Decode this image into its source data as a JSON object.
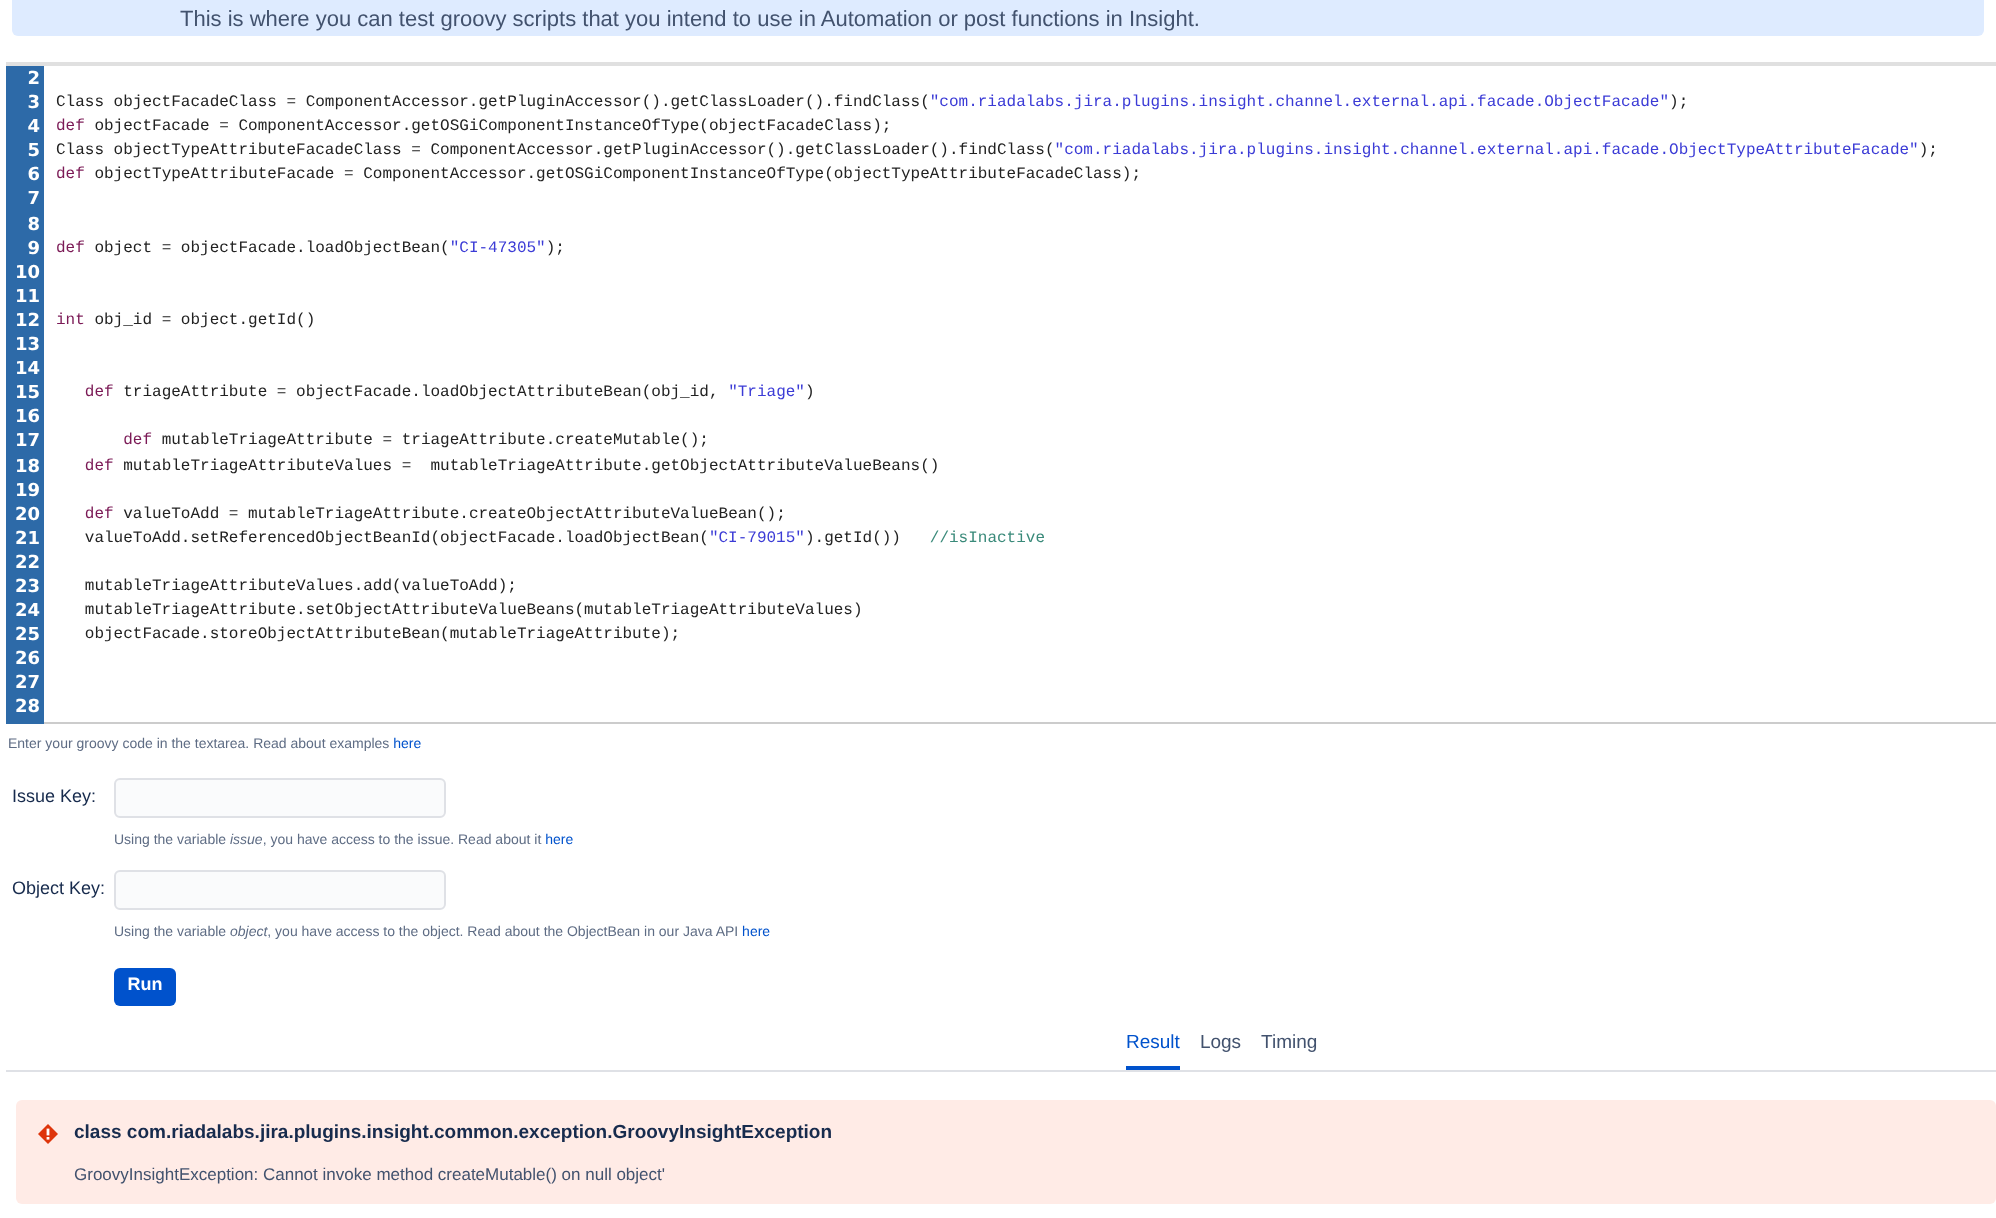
{
  "banner": {
    "text": "This is where you can test groovy scripts that you intend to use in Automation or post functions in Insight."
  },
  "editor": {
    "lines": [
      {
        "number": "2"
      },
      {
        "number": "3",
        "tokens": [
          {
            "kind": "plain",
            "text": "Class objectFacadeClass = ComponentAccessor.getPluginAccessor().getClassLoader().findClass("
          },
          {
            "kind": "string",
            "text": "\"com.riadalabs.jira.plugins.insight.channel.external.api.facade.ObjectFacade\""
          },
          {
            "kind": "plain",
            "text": ");"
          }
        ]
      },
      {
        "number": "4",
        "tokens": [
          {
            "kind": "keyword",
            "text": "def"
          },
          {
            "kind": "plain",
            "text": " objectFacade = ComponentAccessor.getOSGiComponentInstanceOfType(objectFacadeClass);"
          }
        ]
      },
      {
        "number": "5",
        "tokens": [
          {
            "kind": "plain",
            "text": "Class objectTypeAttributeFacadeClass = ComponentAccessor.getPluginAccessor().getClassLoader().findClass("
          },
          {
            "kind": "string",
            "text": "\"com.riadalabs.jira.plugins.insight.channel.external.api.facade.ObjectTypeAttributeFacade\""
          },
          {
            "kind": "plain",
            "text": ");"
          }
        ]
      },
      {
        "number": "6",
        "tokens": [
          {
            "kind": "keyword",
            "text": "def"
          },
          {
            "kind": "plain",
            "text": " objectTypeAttributeFacade = ComponentAccessor.getOSGiComponentInstanceOfType(objectTypeAttributeFacadeClass);"
          }
        ]
      },
      {
        "number": "7"
      },
      {
        "number": "8"
      },
      {
        "number": "9",
        "tokens": [
          {
            "kind": "keyword",
            "text": "def"
          },
          {
            "kind": "plain",
            "text": " object = objectFacade.loadObjectBean("
          },
          {
            "kind": "string",
            "text": "\"CI-47305\""
          },
          {
            "kind": "plain",
            "text": ");"
          }
        ]
      },
      {
        "number": "10"
      },
      {
        "number": "11"
      },
      {
        "number": "12",
        "tokens": [
          {
            "kind": "keyword",
            "text": "int"
          },
          {
            "kind": "plain",
            "text": " obj_id = object.getId()"
          }
        ]
      },
      {
        "number": "13"
      },
      {
        "number": "14"
      },
      {
        "number": "15",
        "tokens": [
          {
            "kind": "keyword",
            "text": "   def"
          },
          {
            "kind": "plain",
            "text": " triageAttribute = objectFacade.loadObjectAttributeBean(obj_id, "
          },
          {
            "kind": "string",
            "text": "\"Triage\""
          },
          {
            "kind": "plain",
            "text": ")"
          }
        ]
      },
      {
        "number": "16"
      },
      {
        "number": "17",
        "tokens": [
          {
            "kind": "keyword",
            "text": "       def"
          },
          {
            "kind": "plain",
            "text": " mutableTriageAttribute = triageAttribute.createMutable();"
          }
        ]
      },
      {
        "number": "18",
        "tokens": [
          {
            "kind": "keyword",
            "text": "   def"
          },
          {
            "kind": "plain",
            "text": " mutableTriageAttributeValues =  mutableTriageAttribute.getObjectAttributeValueBeans()"
          }
        ]
      },
      {
        "number": "19"
      },
      {
        "number": "20",
        "tokens": [
          {
            "kind": "keyword",
            "text": "   def"
          },
          {
            "kind": "plain",
            "text": " valueToAdd = mutableTriageAttribute.createObjectAttributeValueBean();"
          }
        ]
      },
      {
        "number": "21",
        "tokens": [
          {
            "kind": "plain",
            "text": "   valueToAdd.setReferencedObjectBeanId(objectFacade.loadObjectBean("
          },
          {
            "kind": "string",
            "text": "\"CI-79015\""
          },
          {
            "kind": "plain",
            "text": ").getId())   "
          },
          {
            "kind": "comment",
            "text": "//isInactive"
          }
        ]
      },
      {
        "number": "22"
      },
      {
        "number": "23",
        "tokens": [
          {
            "kind": "plain",
            "text": "   mutableTriageAttributeValues.add(valueToAdd);"
          }
        ]
      },
      {
        "number": "24",
        "tokens": [
          {
            "kind": "plain",
            "text": "   mutableTriageAttribute.setObjectAttributeValueBeans(mutableTriageAttributeValues)"
          }
        ]
      },
      {
        "number": "25",
        "tokens": [
          {
            "kind": "plain",
            "text": "   objectFacade.storeObjectAttributeBean(mutableTriageAttribute);"
          }
        ]
      },
      {
        "number": "26"
      },
      {
        "number": "27"
      },
      {
        "number": "28"
      }
    ]
  },
  "editor_hint": {
    "text": "Enter your groovy code in the textarea. Read about examples",
    "link": "here"
  },
  "fields": [
    {
      "label": "Issue Key:",
      "hint": "Using the variable *issue*, you have access to the issue. Read about it",
      "link": "here"
    },
    {
      "label": "Object Key:",
      "hint": "Using the variable *object*, you have access to the object. Read about the ObjectBean in our Java API",
      "link": "here"
    }
  ],
  "run_button": "Run",
  "tabs": [
    {
      "label": "Result",
      "selected": true
    },
    {
      "label": "Logs",
      "selected": false
    },
    {
      "label": "Timing",
      "selected": false
    }
  ],
  "error": {
    "title": "class com.riadalabs.jira.plugins.insight.common.exception.GroovyInsightException",
    "message": "GroovyInsightException: Cannot invoke method createMutable() on null object'"
  }
}
